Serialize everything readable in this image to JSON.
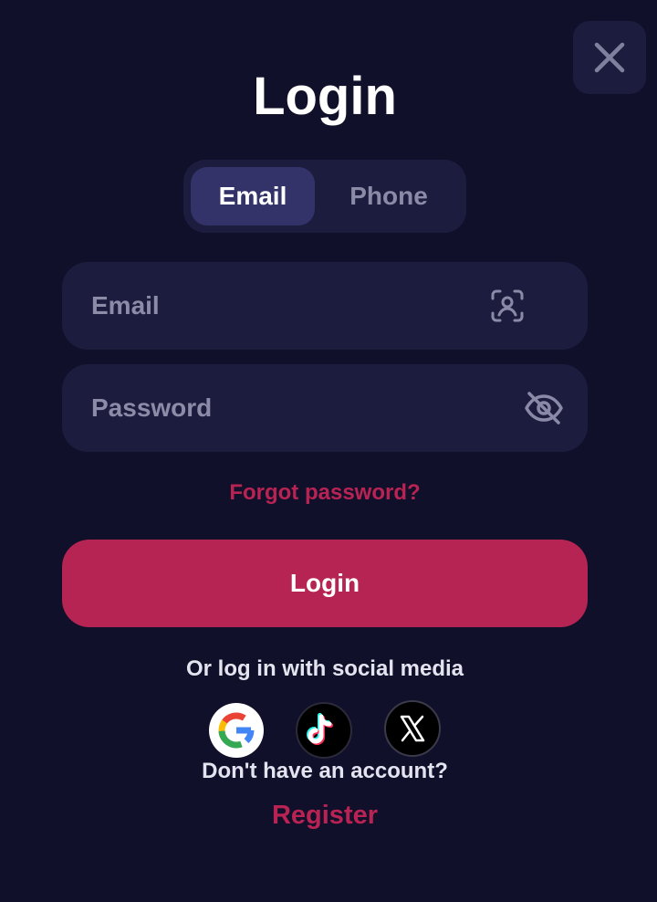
{
  "modal": {
    "title": "Login",
    "close_icon": "close-icon"
  },
  "tabs": [
    {
      "label": "Email",
      "active": true
    },
    {
      "label": "Phone",
      "active": false
    }
  ],
  "fields": {
    "email": {
      "value": "",
      "placeholder": "Email",
      "icon": "user-scan-icon"
    },
    "password": {
      "value": "",
      "placeholder": "Password",
      "icon": "eye-off-icon"
    }
  },
  "forgot_password": "Forgot password?",
  "login_button": "Login",
  "social": {
    "caption": "Or log in with social media",
    "providers": [
      {
        "name": "google",
        "icon": "google-icon"
      },
      {
        "name": "tiktok",
        "icon": "tiktok-icon"
      },
      {
        "name": "x",
        "icon": "x-icon"
      }
    ]
  },
  "signup": {
    "prompt": "Don't have an account?",
    "link": "Register"
  },
  "colors": {
    "background": "#10102b",
    "surface": "#1c1c3e",
    "tab_active": "#33336a",
    "accent": "#b52453",
    "text": "#ffffff",
    "muted": "#8d8ca8"
  }
}
